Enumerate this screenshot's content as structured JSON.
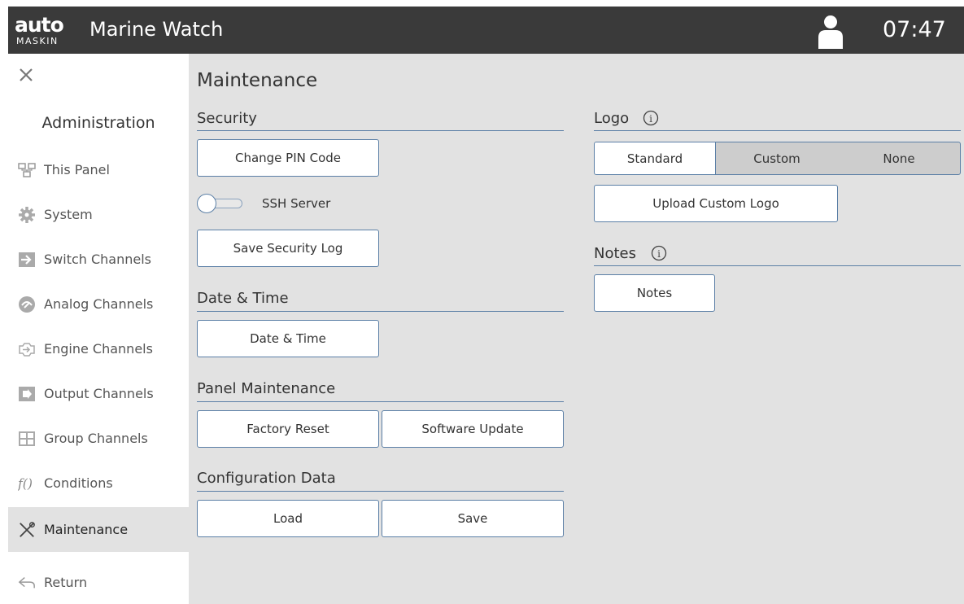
{
  "header": {
    "logo_word": "auto",
    "logo_sub": "MASKIN",
    "app_title": "Marine Watch",
    "clock": "07:47"
  },
  "sidebar": {
    "heading": "Administration",
    "items": [
      {
        "label": "This Panel",
        "icon": "panel-icon"
      },
      {
        "label": "System",
        "icon": "gear-icon"
      },
      {
        "label": "Switch Channels",
        "icon": "switch-channels-icon"
      },
      {
        "label": "Analog Channels",
        "icon": "analog-channels-icon"
      },
      {
        "label": "Engine Channels",
        "icon": "engine-channels-icon"
      },
      {
        "label": "Output Channels",
        "icon": "output-channels-icon"
      },
      {
        "label": "Group Channels",
        "icon": "group-channels-icon"
      },
      {
        "label": "Conditions",
        "icon": "function-icon"
      },
      {
        "label": "Maintenance",
        "icon": "tools-icon",
        "active": true
      },
      {
        "label": "Return",
        "icon": "return-arrow-icon"
      }
    ]
  },
  "main": {
    "title": "Maintenance",
    "security": {
      "title": "Security",
      "change_pin": "Change PIN Code",
      "ssh_label": "SSH Server",
      "ssh_enabled": false,
      "save_log": "Save Security Log"
    },
    "datetime": {
      "title": "Date & Time",
      "button": "Date & Time"
    },
    "panel_maintenance": {
      "title": "Panel Maintenance",
      "factory_reset": "Factory Reset",
      "software_update": "Software Update"
    },
    "config": {
      "title": "Configuration Data",
      "load": "Load",
      "save": "Save"
    },
    "logo": {
      "title": "Logo",
      "options": [
        "Standard",
        "Custom",
        "None"
      ],
      "selected": "Standard",
      "upload": "Upload Custom Logo"
    },
    "notes": {
      "title": "Notes",
      "button": "Notes"
    }
  },
  "colors": {
    "header_bg": "#3a3a3a",
    "main_bg": "#e2e2e2",
    "accent_line": "#5b7fa6"
  }
}
